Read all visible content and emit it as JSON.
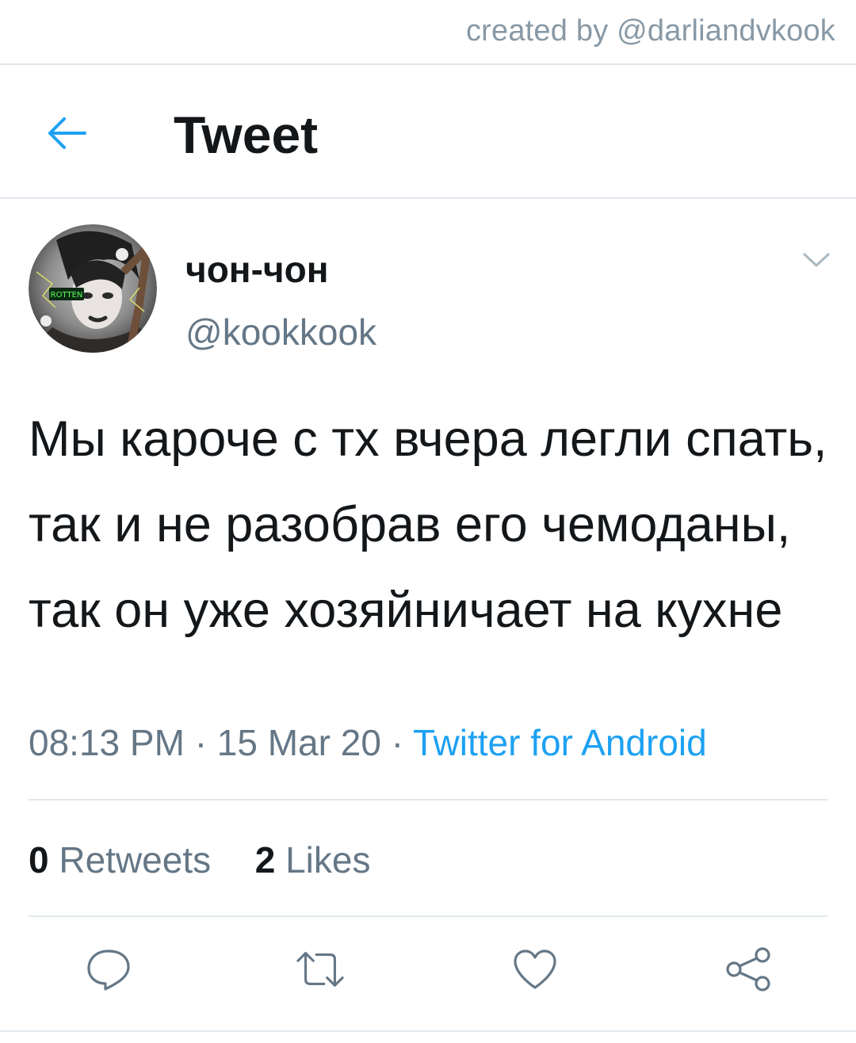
{
  "credit": "created by @darliandvkook",
  "header": {
    "title": "Tweet",
    "back_icon": "back-arrow-icon"
  },
  "tweet": {
    "author": {
      "name": "чон-чон",
      "handle": "@kookkook",
      "avatar_badge": "ROTTEN"
    },
    "text": "Мы кароче с тх вчера легли спать, так и не разобрав его чемоданы, так он уже хозяйничает на кухне",
    "time": "08:13 PM",
    "date": "15 Mar 20",
    "separator": "·",
    "source": "Twitter for Android",
    "stats": {
      "retweets_count": "0",
      "retweets_label": "Retweets",
      "likes_count": "2",
      "likes_label": "Likes"
    }
  },
  "actions": [
    "reply-icon",
    "retweet-icon",
    "like-icon",
    "share-icon"
  ],
  "colors": {
    "accent": "#1da1f2",
    "text": "#14171a",
    "secondary": "#657786",
    "divider": "#e1e8ed",
    "icon": "#657786"
  }
}
